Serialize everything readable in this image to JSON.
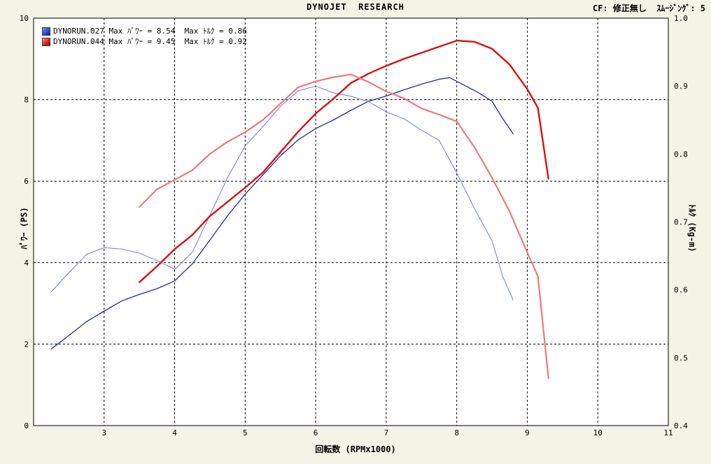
{
  "header": {
    "title": "DYNOJET  RESEARCH",
    "right": "CF: 修正無し  ｽﾑｰｼﾞﾝｸﾞ: 5"
  },
  "legend": [
    {
      "label": "DYNORUN.027 Max ﾊﾟﾜｰ = 8.54  Max ﾄﾙｸ = 0.86",
      "color": "#2b4fd6"
    },
    {
      "label": "DYNORUN.044 Max ﾊﾟﾜｰ = 9.45  Max ﾄﾙｸ = 0.92",
      "color": "#dd2222"
    }
  ],
  "colors": {
    "blue_power": "#0d1a9a",
    "blue_torque": "#6f79e6",
    "red_power": "#d81010",
    "red_torque": "#f07878",
    "grid": "#000000",
    "plot_bg": "#ffffff"
  },
  "chart_data": {
    "type": "line",
    "title": "DYNOJET  RESEARCH",
    "xlabel": "回転数 (RPMx1000)",
    "ylabel_left": "ﾊﾟﾜｰ (PS)",
    "ylabel_right": "ﾄﾙｸ (Kg-m)",
    "xlim": [
      2.0,
      11.0
    ],
    "ylim_left": [
      0,
      10
    ],
    "ylim_right": [
      0.4,
      1.0
    ],
    "xticks": [
      "3",
      "4",
      "5",
      "6",
      "7",
      "8",
      "9",
      "10",
      "11"
    ],
    "yticks_left": [
      "0",
      "2",
      "4",
      "6",
      "8",
      "10"
    ],
    "yticks_right": [
      "0.4",
      "0.5",
      "0.6",
      "0.7",
      "0.8",
      "0.9",
      "1.0"
    ],
    "grid": true,
    "legend_position": "top-left",
    "series": [
      {
        "name": "DYNORUN.027",
        "axis": "left",
        "color_key": "blue_power",
        "x": [
          2.25,
          2.5,
          2.75,
          3.0,
          3.25,
          3.5,
          3.75,
          4.0,
          4.25,
          4.5,
          4.75,
          5.0,
          5.25,
          5.5,
          5.75,
          6.0,
          6.25,
          6.5,
          6.75,
          7.0,
          7.25,
          7.5,
          7.75,
          7.9,
          8.1,
          8.3,
          8.5,
          8.65,
          8.8
        ],
        "y": [
          1.88,
          2.21,
          2.55,
          2.81,
          3.06,
          3.22,
          3.36,
          3.55,
          3.97,
          4.55,
          5.15,
          5.68,
          6.15,
          6.62,
          7.01,
          7.29,
          7.5,
          7.74,
          7.96,
          8.09,
          8.24,
          8.38,
          8.5,
          8.54,
          8.36,
          8.18,
          7.96,
          7.54,
          7.16
        ]
      },
      {
        "name": "DYNORUN.027",
        "axis": "right",
        "color_key": "blue_torque",
        "x": [
          2.25,
          2.5,
          2.75,
          3.0,
          3.25,
          3.5,
          3.75,
          4.0,
          4.25,
          4.5,
          4.75,
          5.0,
          5.25,
          5.5,
          5.75,
          6.0,
          6.25,
          6.5,
          6.75,
          7.0,
          7.25,
          7.5,
          7.75,
          8.0,
          8.25,
          8.5,
          8.65,
          8.8
        ],
        "y": [
          0.597,
          0.625,
          0.652,
          0.662,
          0.66,
          0.654,
          0.643,
          0.63,
          0.655,
          0.71,
          0.765,
          0.812,
          0.84,
          0.87,
          0.893,
          0.9,
          0.89,
          0.885,
          0.877,
          0.862,
          0.852,
          0.835,
          0.82,
          0.772,
          0.72,
          0.672,
          0.62,
          0.585
        ]
      },
      {
        "name": "DYNORUN.044",
        "axis": "left",
        "color_key": "red_power",
        "x": [
          3.5,
          3.75,
          4.0,
          4.25,
          4.5,
          4.75,
          5.0,
          5.25,
          5.5,
          5.75,
          6.0,
          6.25,
          6.5,
          6.75,
          7.0,
          7.25,
          7.5,
          7.75,
          8.0,
          8.25,
          8.5,
          8.75,
          9.0,
          9.15,
          9.3
        ],
        "y": [
          3.52,
          3.91,
          4.33,
          4.68,
          5.14,
          5.49,
          5.84,
          6.21,
          6.71,
          7.21,
          7.66,
          8.02,
          8.41,
          8.64,
          8.83,
          9.0,
          9.15,
          9.3,
          9.45,
          9.42,
          9.25,
          8.86,
          8.26,
          7.8,
          6.06
        ]
      },
      {
        "name": "DYNORUN.044",
        "axis": "right",
        "color_key": "red_torque",
        "x": [
          3.5,
          3.75,
          4.0,
          4.25,
          4.5,
          4.75,
          5.0,
          5.25,
          5.5,
          5.75,
          6.0,
          6.25,
          6.5,
          6.75,
          7.0,
          7.25,
          7.5,
          7.75,
          8.0,
          8.25,
          8.5,
          8.75,
          9.0,
          9.15,
          9.3
        ],
        "y": [
          0.722,
          0.748,
          0.762,
          0.776,
          0.8,
          0.818,
          0.832,
          0.85,
          0.874,
          0.898,
          0.907,
          0.913,
          0.917,
          0.906,
          0.892,
          0.882,
          0.867,
          0.858,
          0.848,
          0.81,
          0.765,
          0.715,
          0.655,
          0.62,
          0.47
        ]
      }
    ]
  }
}
